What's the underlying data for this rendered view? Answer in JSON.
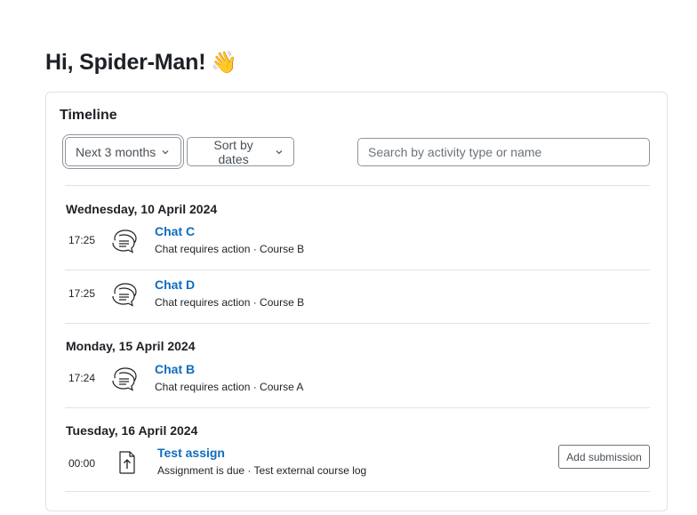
{
  "greeting": {
    "text": "Hi, Spider-Man!",
    "emoji": "👋"
  },
  "timeline": {
    "title": "Timeline",
    "filter_label": "Next 3 months",
    "sort_label": "Sort by dates",
    "search_placeholder": "Search by activity type or name",
    "groups": [
      {
        "date": "Wednesday, 10 April 2024",
        "events": [
          {
            "time": "17:25",
            "icon": "chat-icon",
            "name": "Chat C",
            "desc": "Chat requires action · Course B"
          },
          {
            "time": "17:25",
            "icon": "chat-icon",
            "name": "Chat D",
            "desc": "Chat requires action · Course B"
          }
        ]
      },
      {
        "date": "Monday, 15 April 2024",
        "events": [
          {
            "time": "17:24",
            "icon": "chat-icon",
            "name": "Chat B",
            "desc": "Chat requires action · Course A"
          }
        ]
      },
      {
        "date": "Tuesday, 16 April 2024",
        "events": [
          {
            "time": "00:00",
            "icon": "assignment-upload-icon",
            "name": "Test assign",
            "desc": "Assignment is due · Test external course log",
            "action": "Add submission"
          }
        ]
      }
    ]
  },
  "colors": {
    "link": "#0f6cbf",
    "border": "#dee2e6",
    "text": "#1d2125"
  }
}
